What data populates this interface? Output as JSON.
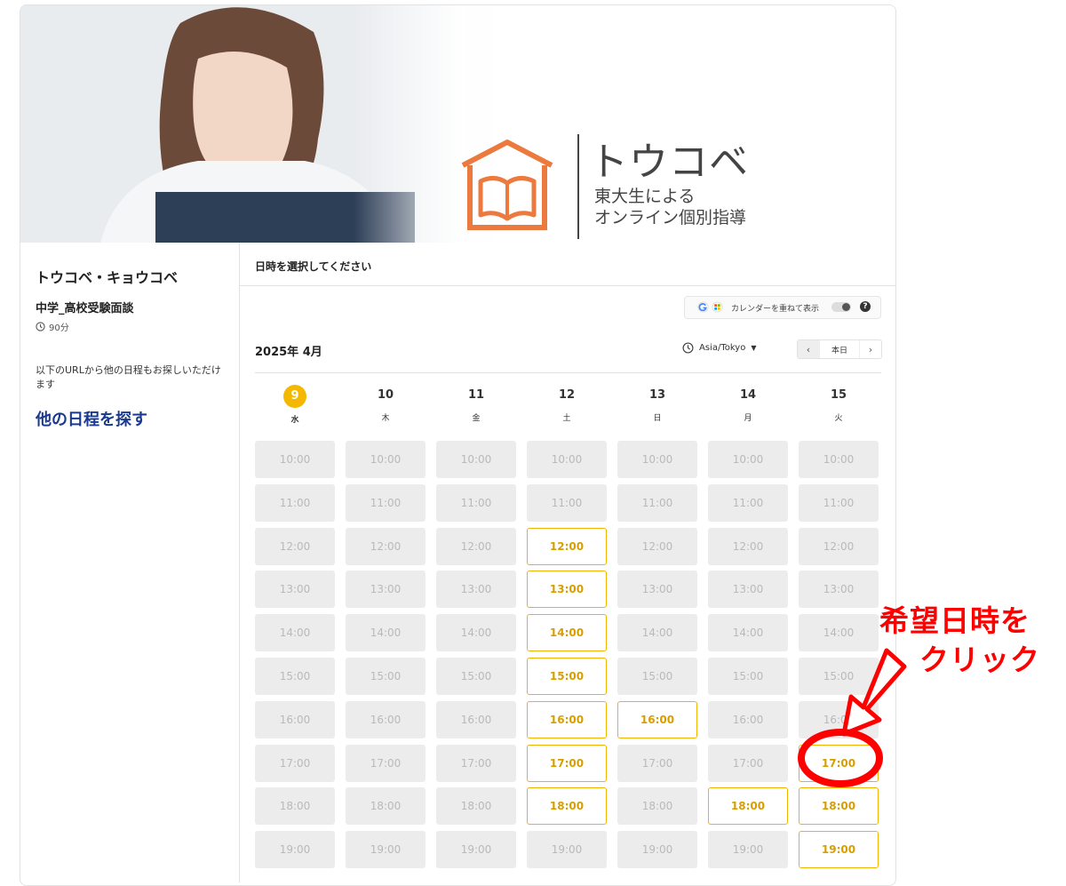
{
  "banner": {
    "logo_name": "トウコベ",
    "logo_sub1": "東大生による",
    "logo_sub2": "オンライン個別指導"
  },
  "left": {
    "org_name": "トウコベ・キョウコベ",
    "event_name": "中学_高校受験面談",
    "duration": "90分",
    "note": "以下のURLから他の日程もお探しいただけます",
    "other_link": "他の日程を探す"
  },
  "right": {
    "title": "日時を選択してください",
    "overlay_label": "カレンダーを重ねて表示",
    "month": "2025年 4月",
    "timezone": "Asia/Tokyo",
    "today_label": "本日"
  },
  "days": [
    {
      "num": "9",
      "wd": "水",
      "active": true
    },
    {
      "num": "10",
      "wd": "木",
      "active": false
    },
    {
      "num": "11",
      "wd": "金",
      "active": false
    },
    {
      "num": "12",
      "wd": "土",
      "active": false
    },
    {
      "num": "13",
      "wd": "日",
      "active": false
    },
    {
      "num": "14",
      "wd": "月",
      "active": false
    },
    {
      "num": "15",
      "wd": "火",
      "active": false
    }
  ],
  "times": [
    "10:00",
    "11:00",
    "12:00",
    "13:00",
    "14:00",
    "15:00",
    "16:00",
    "17:00",
    "18:00",
    "19:00"
  ],
  "available": {
    "12": [
      "12:00",
      "13:00",
      "14:00",
      "15:00",
      "16:00",
      "17:00",
      "18:00"
    ],
    "13": [
      "16:00"
    ],
    "14": [
      "18:00"
    ],
    "15": [
      "17:00",
      "18:00",
      "19:00"
    ]
  },
  "annotation": {
    "line1": "希望日時を",
    "line2": "クリック"
  },
  "colors": {
    "accent": "#f5b800",
    "available_border": "#f0b400",
    "link": "#1a3a8f",
    "annotation": "#ff0000"
  }
}
